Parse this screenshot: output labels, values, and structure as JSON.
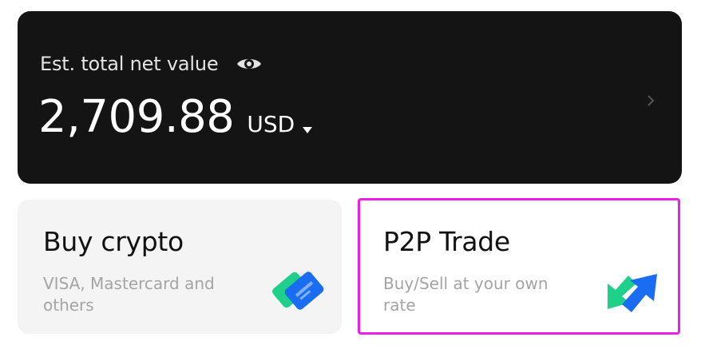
{
  "balance": {
    "label": "Est. total net value",
    "amount": "2,709.88",
    "currency": "USD"
  },
  "actions": [
    {
      "title": "Buy crypto",
      "subtitle": "VISA, Mastercard and others",
      "icon": "card-icon"
    },
    {
      "title": "P2P Trade",
      "subtitle": "Buy/Sell at your own rate",
      "icon": "swap-arrows-icon"
    }
  ],
  "colors": {
    "card_dark": "#141414",
    "accent_green": "#1fd08a",
    "accent_blue": "#1a6cf0",
    "highlight": "#ee1ee9"
  }
}
